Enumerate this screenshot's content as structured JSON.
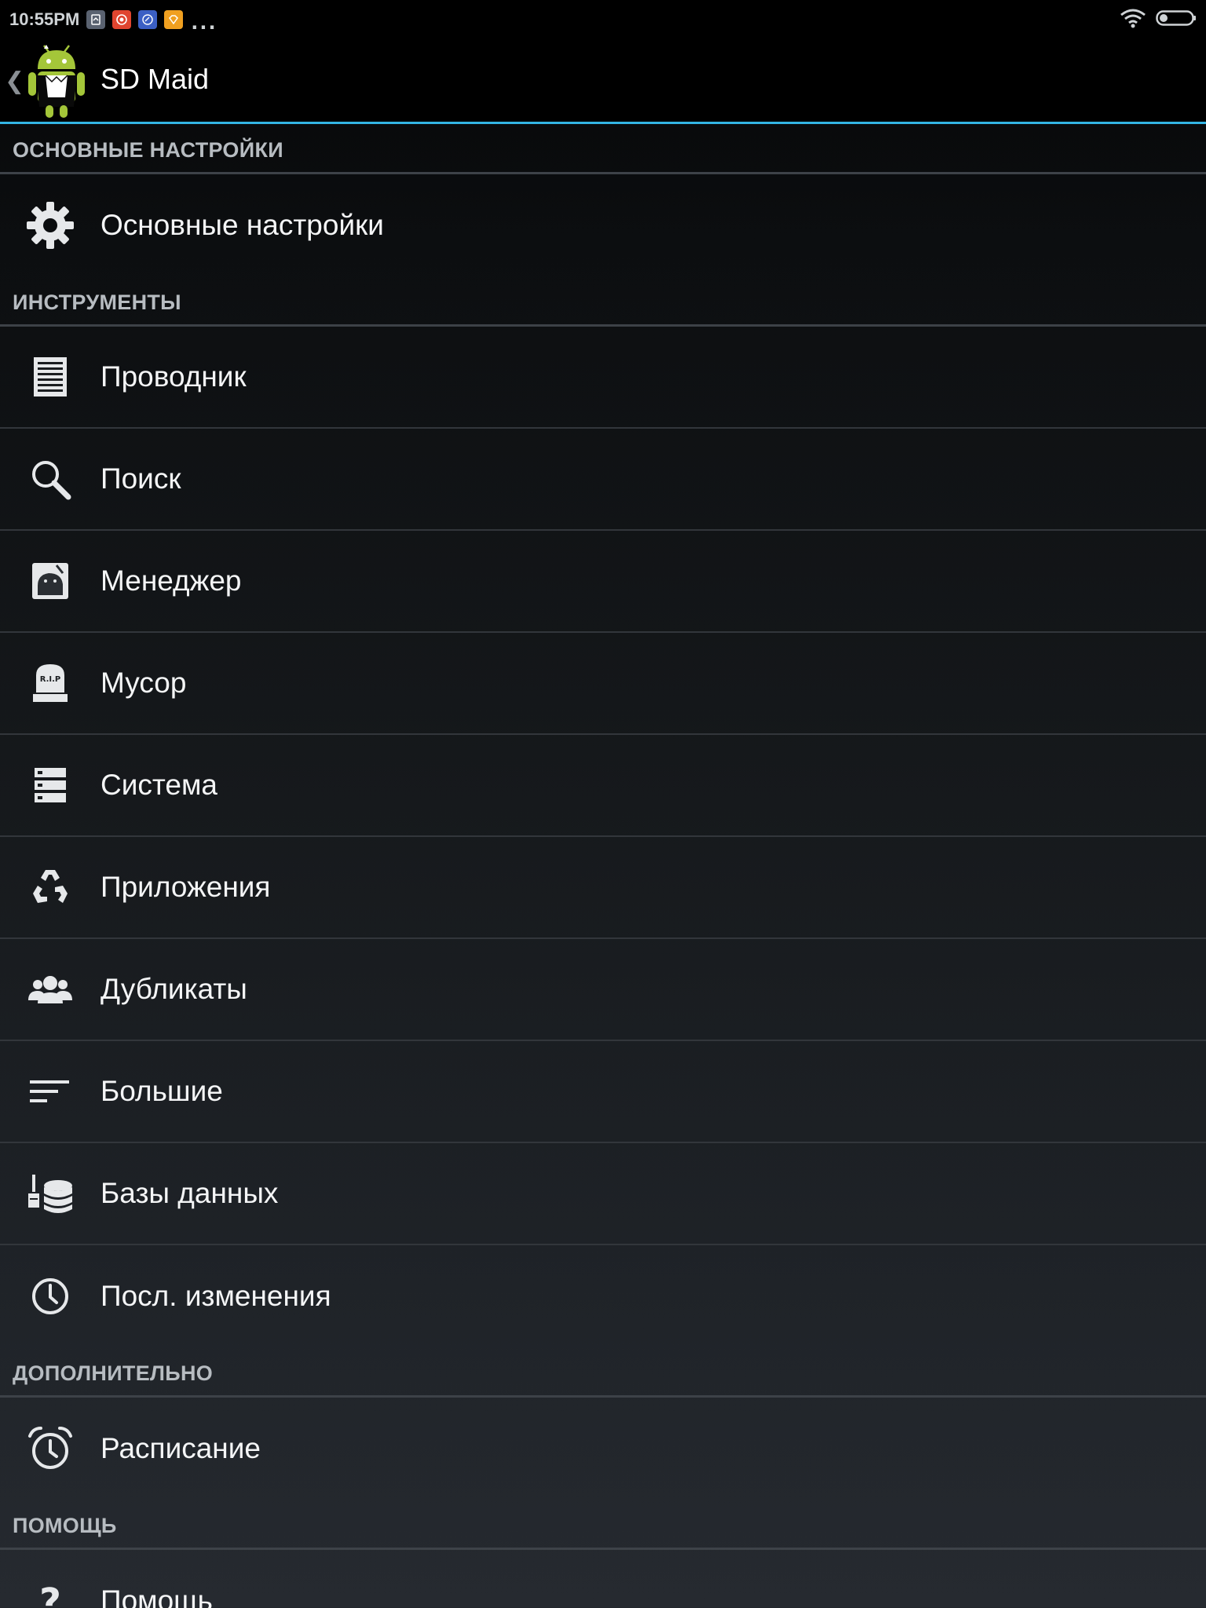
{
  "status_bar": {
    "time": "10:55PM",
    "notifications": [
      {
        "icon": "app-notification-icon",
        "color": "#5a6270"
      },
      {
        "icon": "record-notification-icon",
        "color": "#e0452f"
      },
      {
        "icon": "sync-notification-icon",
        "color": "#3b5fc4"
      },
      {
        "icon": "diamond-notification-icon",
        "color": "#f0a020"
      }
    ],
    "more": "...",
    "wifi_icon": "wifi-icon",
    "battery_icon": "battery-icon"
  },
  "action_bar": {
    "up_icon": "chevron-left-icon",
    "logo_icon": "sd-maid-android-logo",
    "title": "SD Maid",
    "accent_color": "#33b5e5"
  },
  "sections": [
    {
      "header": "ОСНОВНЫЕ НАСТРОЙКИ",
      "items": [
        {
          "label": "Основные настройки",
          "icon": "gear-icon"
        }
      ]
    },
    {
      "header": "ИНСТРУМЕНТЫ",
      "items": [
        {
          "label": "Проводник",
          "icon": "file-explorer-icon"
        },
        {
          "label": "Поиск",
          "icon": "search-icon"
        },
        {
          "label": "Менеджер",
          "icon": "app-manager-icon"
        },
        {
          "label": "Мусор",
          "icon": "tombstone-icon"
        },
        {
          "label": "Система",
          "icon": "system-storage-icon"
        },
        {
          "label": "Приложения",
          "icon": "recycle-icon"
        },
        {
          "label": "Дубликаты",
          "icon": "duplicates-people-icon"
        },
        {
          "label": "Большие",
          "icon": "sort-lines-icon"
        },
        {
          "label": "Базы данных",
          "icon": "database-broom-icon"
        },
        {
          "label": "Посл. изменения",
          "icon": "clock-icon"
        }
      ]
    },
    {
      "header": "ДОПОЛНИТЕЛЬНО",
      "items": [
        {
          "label": "Расписание",
          "icon": "alarm-clock-icon"
        }
      ]
    },
    {
      "header": "ПОМОЩЬ",
      "items": [
        {
          "label": "Помощь",
          "icon": "question-mark-icon"
        }
      ]
    }
  ]
}
